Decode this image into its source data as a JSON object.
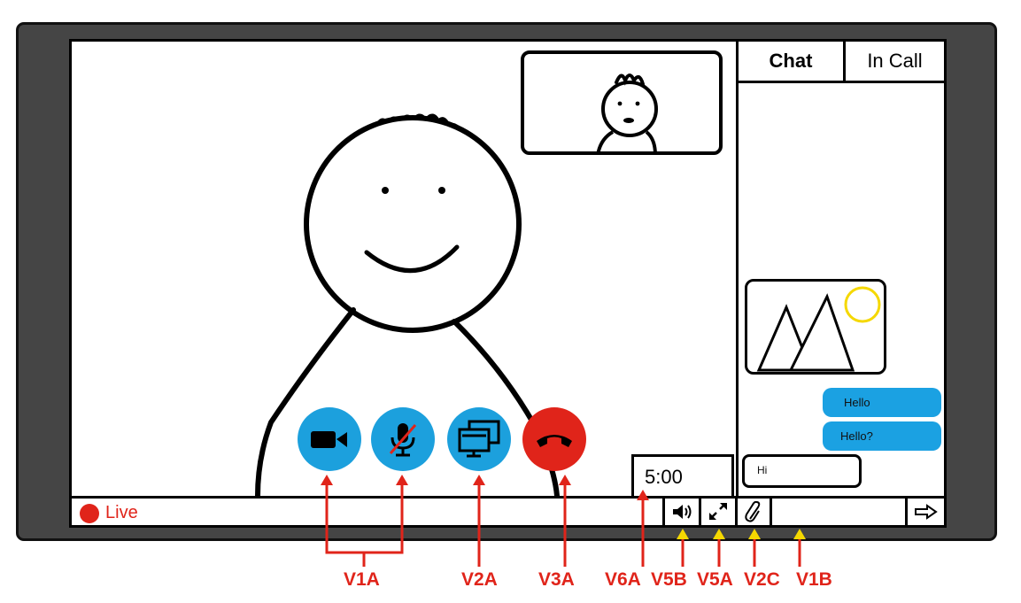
{
  "tabs": {
    "chat": "Chat",
    "in_call": "In Call"
  },
  "timer": "5:00",
  "live_label": "Live",
  "chat": {
    "messages": [
      {
        "text": "Hello",
        "side": "sent"
      },
      {
        "text": "Hello?",
        "side": "sent"
      },
      {
        "text": "Hi",
        "side": "received"
      }
    ],
    "input_value": ""
  },
  "controls": [
    "camera",
    "microphone-muted",
    "screen-share",
    "end-call"
  ],
  "bar_icons": [
    "speaker-icon",
    "expand-icon",
    "paperclip-icon",
    "arrow-right-icon"
  ],
  "annotations": {
    "v1a": "V1A",
    "v2a": "V2A",
    "v3a": "V3A",
    "v6a": "V6A",
    "v5b": "V5B",
    "v5a": "V5A",
    "v2c": "V2C",
    "v1b": "V1B"
  },
  "colors": {
    "accent_blue": "#1ca0dd",
    "danger_red": "#e0241a",
    "annotation_yellow": "#f5d800",
    "bezel": "#454545"
  }
}
